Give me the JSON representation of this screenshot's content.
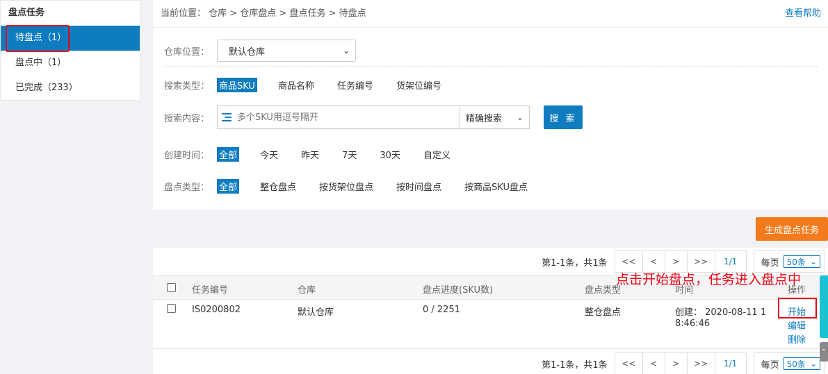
{
  "sidebar": {
    "title": "盘点任务",
    "items": [
      {
        "label": "待盘点（1）"
      },
      {
        "label": "盘点中（1）"
      },
      {
        "label": "已完成（233）"
      }
    ]
  },
  "header": {
    "breadcrumb": "当前位置：  仓库 > 仓库盘点 > 盘点任务 > 待盘点",
    "help": "查看帮助"
  },
  "filters": {
    "warehouse_label": "仓库位置：",
    "warehouse_value": "默认仓库",
    "search_type_label": "搜索类型：",
    "search_types": [
      "商品SKU",
      "商品名称",
      "任务编号",
      "货架位编号"
    ],
    "search_content_label": "搜索内容：",
    "search_placeholder": "多个SKU用逗号隔开",
    "precise_value": "精确搜索",
    "search_button": "搜 索",
    "created_label": "创建时间：",
    "created_options": [
      "全部",
      "今天",
      "昨天",
      "7天",
      "30天",
      "自定义"
    ],
    "type_label": "盘点类型：",
    "type_options": [
      "全部",
      "整仓盘点",
      "按货架位盘点",
      "按时间盘点",
      "按商品SKU盘点"
    ]
  },
  "generate_button": "生成盘点任务",
  "pager": {
    "info": "第1-1条，共1条",
    "first": "<<",
    "prev": "<",
    "next": ">",
    "last": ">>",
    "page": "1/1",
    "per_label": "每页",
    "per_value": "50条"
  },
  "table": {
    "headers": [
      "任务编号",
      "仓库",
      "盘点进度(SKU数)",
      "盘点类型",
      "时间",
      "操作"
    ],
    "rows": [
      {
        "task_no": "IS0200802",
        "warehouse": "默认仓库",
        "progress": "0 / 2251",
        "type": "整仓盘点",
        "time_line1": "创建：  2020-08-11 1",
        "time_line2": "8:46:46",
        "actions": [
          "开始",
          "编辑",
          "删除"
        ]
      }
    ]
  },
  "annotation": "点击开始盘点，任务进入盘点中",
  "colors": {
    "primary": "#0f7cbf",
    "orange": "#f37b1d",
    "annotation": "#e60012"
  }
}
